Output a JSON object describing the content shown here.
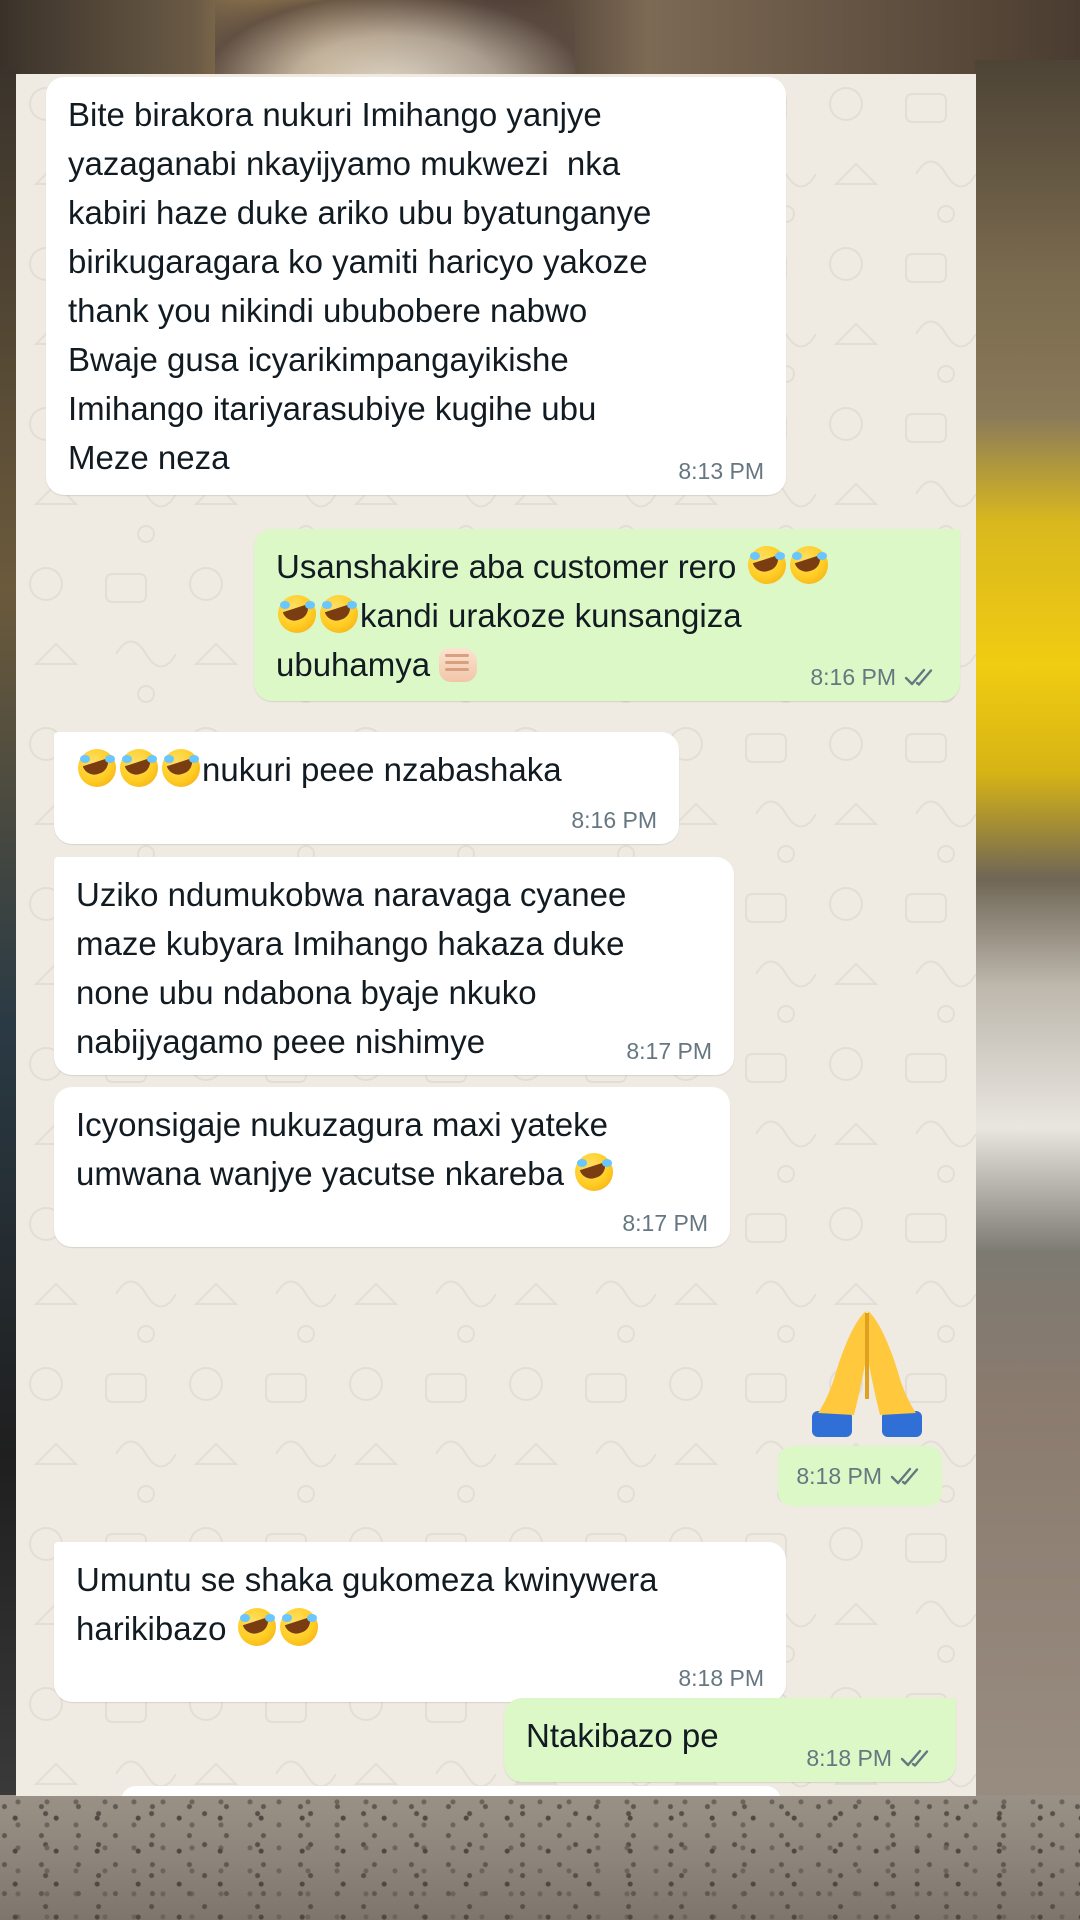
{
  "conversation": {
    "messages": [
      {
        "direction": "in",
        "lines": [
          "Bite birakora nukuri Imihango yanjye",
          "yazaganabi nkayijyamo mukwezi  nka",
          "kabiri haze duke ariko ubu byatunganye",
          "birikugaragara ko yamiti haricyo yakoze",
          "thank you nikindi ububobere nabwo",
          "Bwaje gusa icyarikimpangayikishe",
          "Imihango itariyarasubiye kugihe ubu",
          "Meze neza"
        ],
        "time": "8:13 PM"
      },
      {
        "direction": "out",
        "line1_text": "Usanshakire aba customer rero ",
        "line2_text": "kandi urakoze kunsangiza",
        "line3_text": "ubuhamya ",
        "time": "8:16 PM",
        "status": "read"
      },
      {
        "direction": "in",
        "text": "nukuri peee nzabashaka",
        "time": "8:16 PM"
      },
      {
        "direction": "in",
        "lines": [
          "Uziko ndumukobwa naravaga cyanee",
          "maze kubyara Imihango hakaza duke",
          "none ubu ndabona byaje nkuko",
          "nabijyagamo peee nishimye"
        ],
        "time": "8:17 PM"
      },
      {
        "direction": "in",
        "lines": [
          "Icyonsigaje nukuzagura maxi yateke",
          "umwana wanjye yacutse nkareba "
        ],
        "time": "8:17 PM"
      },
      {
        "direction": "out",
        "emoji": "folded-hands",
        "time": "8:18 PM",
        "status": "read"
      },
      {
        "direction": "in",
        "lines": [
          "Umuntu se shaka gukomeza kwinywera",
          "harikibazo "
        ],
        "time": "8:18 PM"
      },
      {
        "direction": "out",
        "text": "Ntakibazo pe",
        "time": "8:18 PM",
        "status": "read"
      }
    ]
  },
  "icons": {
    "read_receipt": "double-check-icon",
    "laughing_emoji": "rolling-laughing-emoji",
    "fist_emoji": "oncoming-fist-emoji",
    "hands_emoji": "folded-hands-emoji"
  },
  "colors": {
    "chat_background": "#efeae2",
    "incoming_bubble": "#ffffff",
    "outgoing_bubble": "#dcf8c6",
    "text": "#111b21",
    "meta": "#667781",
    "tick": "#667781"
  }
}
